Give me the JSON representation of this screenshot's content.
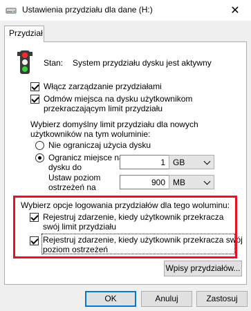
{
  "window": {
    "title": "Ustawienia przydziału dla dane (H:)",
    "close_glyph": "✕",
    "drive_icon": "drive-icon"
  },
  "tabs": [
    {
      "label": "Przydział",
      "active": true
    }
  ],
  "status": {
    "icon": "traffic-light-icon",
    "label": "Stan:",
    "value": "System przydziału dysku jest aktywny"
  },
  "options": {
    "enable_quota": {
      "label": "Włącz zarządzanie przydziałami",
      "checked": true
    },
    "deny_space": {
      "label_line1": "Odmów miejsca na dysku użytkownikom",
      "label_line2": "przekraczającym limit przydziału",
      "checked": true
    }
  },
  "defaults": {
    "heading_line1": "Wybierz domyślny limit przydziału dla nowych",
    "heading_line2": "użytkowników na tym woluminie:",
    "no_limit": {
      "label": "Nie ograniczaj użycia dysku",
      "selected": false
    },
    "limit": {
      "label_line1": "Ogranicz miejsce na",
      "label_line2": "dysku do",
      "selected": true,
      "value": "1",
      "unit": "GB"
    },
    "warning": {
      "label_line1": "Ustaw poziom",
      "label_line2": "ostrzeżeń na",
      "value": "900",
      "unit": "MB"
    }
  },
  "logging": {
    "heading": "Wybierz opcje logowania przydziałów dla tego woluminu:",
    "log_limit": {
      "label_line1": "Rejestruj zdarzenie, kiedy użytkownik przekracza",
      "label_line2": "swój limit przydziału",
      "checked": true
    },
    "log_warning": {
      "label_line1": "Rejestruj zdarzenie, kiedy użytkownik przekracza swój",
      "label_line2": "poziom ostrzeżeń",
      "checked": true
    }
  },
  "buttons": {
    "entries": "Wpisy przydziałów...",
    "ok": "OK",
    "cancel": "Anuluj",
    "apply": "Zastosuj"
  },
  "colors": {
    "highlight": "#e81123",
    "accent": "#0078d7"
  }
}
